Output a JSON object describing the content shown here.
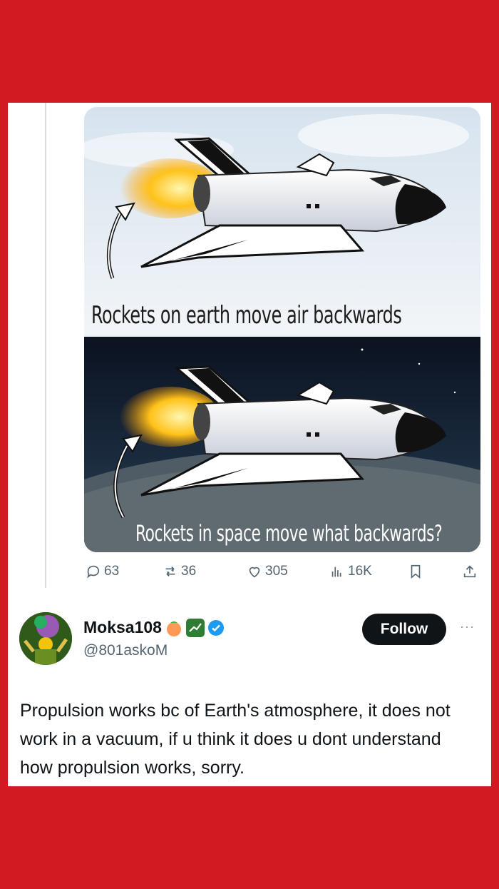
{
  "meme": {
    "top_caption": "Rockets on earth move air backwards",
    "bottom_caption": "Rockets in space move what backwards?"
  },
  "actions": {
    "replies": "63",
    "reposts": "36",
    "likes": "305",
    "views": "16K"
  },
  "reply": {
    "display_name": "Moksa108",
    "handle": "@801askoM",
    "follow_label": "Follow",
    "more_label": "···",
    "text": "Propulsion works bc of Earth's atmosphere, it does not work in a vacuum, if u think it does u dont understand how propulsion works, sorry."
  },
  "colors": {
    "background": "#d11a22",
    "card": "#ffffff",
    "text_primary": "#0f1419",
    "text_secondary": "#536471",
    "verified": "#1d9bf0"
  },
  "icons": [
    "reply-icon",
    "repost-icon",
    "like-icon",
    "views-icon",
    "bookmark-icon",
    "share-icon",
    "verified-icon"
  ]
}
